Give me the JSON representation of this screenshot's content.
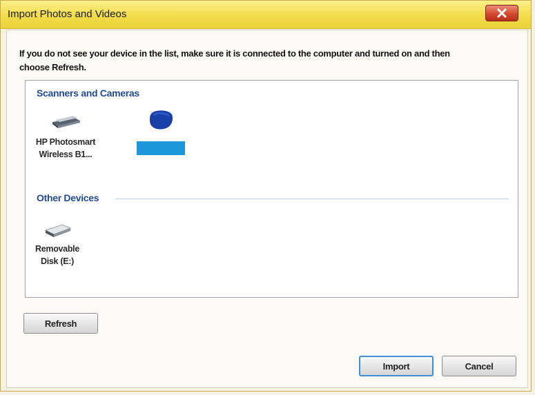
{
  "window": {
    "title": "Import Photos and Videos",
    "close_icon": "close-icon"
  },
  "instruction": "If you do not see your device in the list, make sure it is connected to the computer and turned on and then choose Refresh.",
  "groups": [
    {
      "header": "Scanners and Cameras",
      "devices": [
        {
          "label_line1": "HP Photosmart",
          "label_line2": "Wireless B1...",
          "icon": "scanner-icon"
        },
        {
          "label_line1": "",
          "label_line2": "",
          "icon": "camera-device-icon",
          "label_redacted": true
        }
      ]
    },
    {
      "header": "Other Devices",
      "devices": [
        {
          "label_line1": "Removable",
          "label_line2": "Disk (E:)",
          "icon": "removable-disk-icon"
        }
      ]
    }
  ],
  "buttons": {
    "refresh": "Refresh",
    "import": "Import",
    "cancel": "Cancel"
  },
  "colors": {
    "title_bar": "#f2dc4a",
    "group_header": "#1f4a9a",
    "redaction": "#1d97d9",
    "default_button_border": "#3c8ed6",
    "close_button": "#d44a30"
  }
}
